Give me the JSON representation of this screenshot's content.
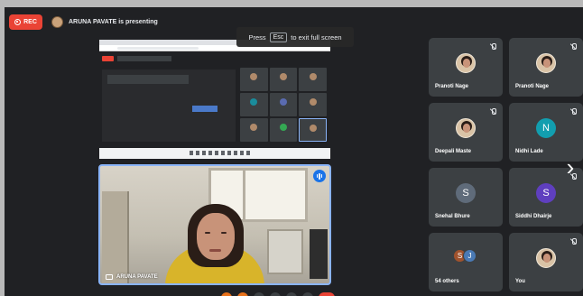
{
  "recording": {
    "label": "REC",
    "color": "#ea4335"
  },
  "presenting": {
    "text": "ARUNA PAVATE is presenting"
  },
  "fullscreen_hint": {
    "prefix": "Press",
    "key": "Esc",
    "suffix": "to exit full screen"
  },
  "presenter_tile": {
    "name": "ARUNA PAVATE",
    "accent": "#8ab4f8"
  },
  "participants": [
    {
      "name": "Pranoti Nage",
      "avatar": "photo",
      "muted": true
    },
    {
      "name": "Pranoti Nage",
      "avatar": "photo",
      "muted": true
    },
    {
      "name": "Deepali Maste",
      "avatar": "photo",
      "muted": true
    },
    {
      "name": "Nidhi Lade",
      "avatar": "N",
      "avatar_color": "#129eaf",
      "muted": true
    },
    {
      "name": "Snehal Bhure",
      "avatar": "S",
      "avatar_color": "#5f6b7a",
      "muted": false
    },
    {
      "name": "Siddhi Dhairje",
      "avatar": "S",
      "avatar_color": "#5f3fbf",
      "muted": true
    }
  ],
  "others": {
    "label": "54 others",
    "initials": [
      "S",
      "J"
    ],
    "colors": [
      "#a0522d",
      "#4a7ab5"
    ]
  },
  "self_tile": {
    "name": "You",
    "avatar": "photo",
    "muted": true
  },
  "next_icon": "chevron-right-icon"
}
